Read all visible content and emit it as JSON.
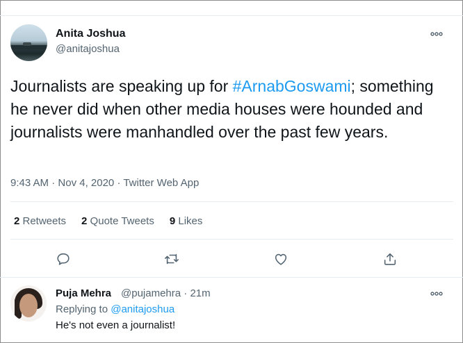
{
  "tweet": {
    "author_name": "Anita Joshua",
    "author_handle": "@anitajoshua",
    "text_before": "Journalists are speaking up for ",
    "hashtag": "#ArnabGoswami",
    "text_after": "; something he never did when other media houses were hounded and journalists were manhandled over the past few years.",
    "time": "9:43 AM",
    "dot1": " · ",
    "date": "Nov 4, 2020",
    "dot2": " · ",
    "source": "Twitter Web App",
    "more_icon": "more-horizontal-icon"
  },
  "stats": {
    "retweets_count": "2",
    "retweets_label": " Retweets",
    "quotes_count": "2",
    "quotes_label": " Quote Tweets",
    "likes_count": "9",
    "likes_label": " Likes"
  },
  "actions": {
    "reply_icon": "reply-icon",
    "retweet_icon": "retweet-icon",
    "like_icon": "like-icon",
    "share_icon": "share-icon",
    "icon_color": "#536471"
  },
  "reply": {
    "author_name": "Puja Mehra",
    "author_handle": "@pujamehra",
    "dot": " · ",
    "age": "21m",
    "replying_prefix": "Replying to ",
    "replying_to": "@anitajoshua",
    "text": "He's not even a journalist!"
  },
  "colors": {
    "accent": "#1d9bf0",
    "secondary_text": "#536471",
    "primary_text": "#0f1419",
    "divider": "#e6ecf0"
  }
}
